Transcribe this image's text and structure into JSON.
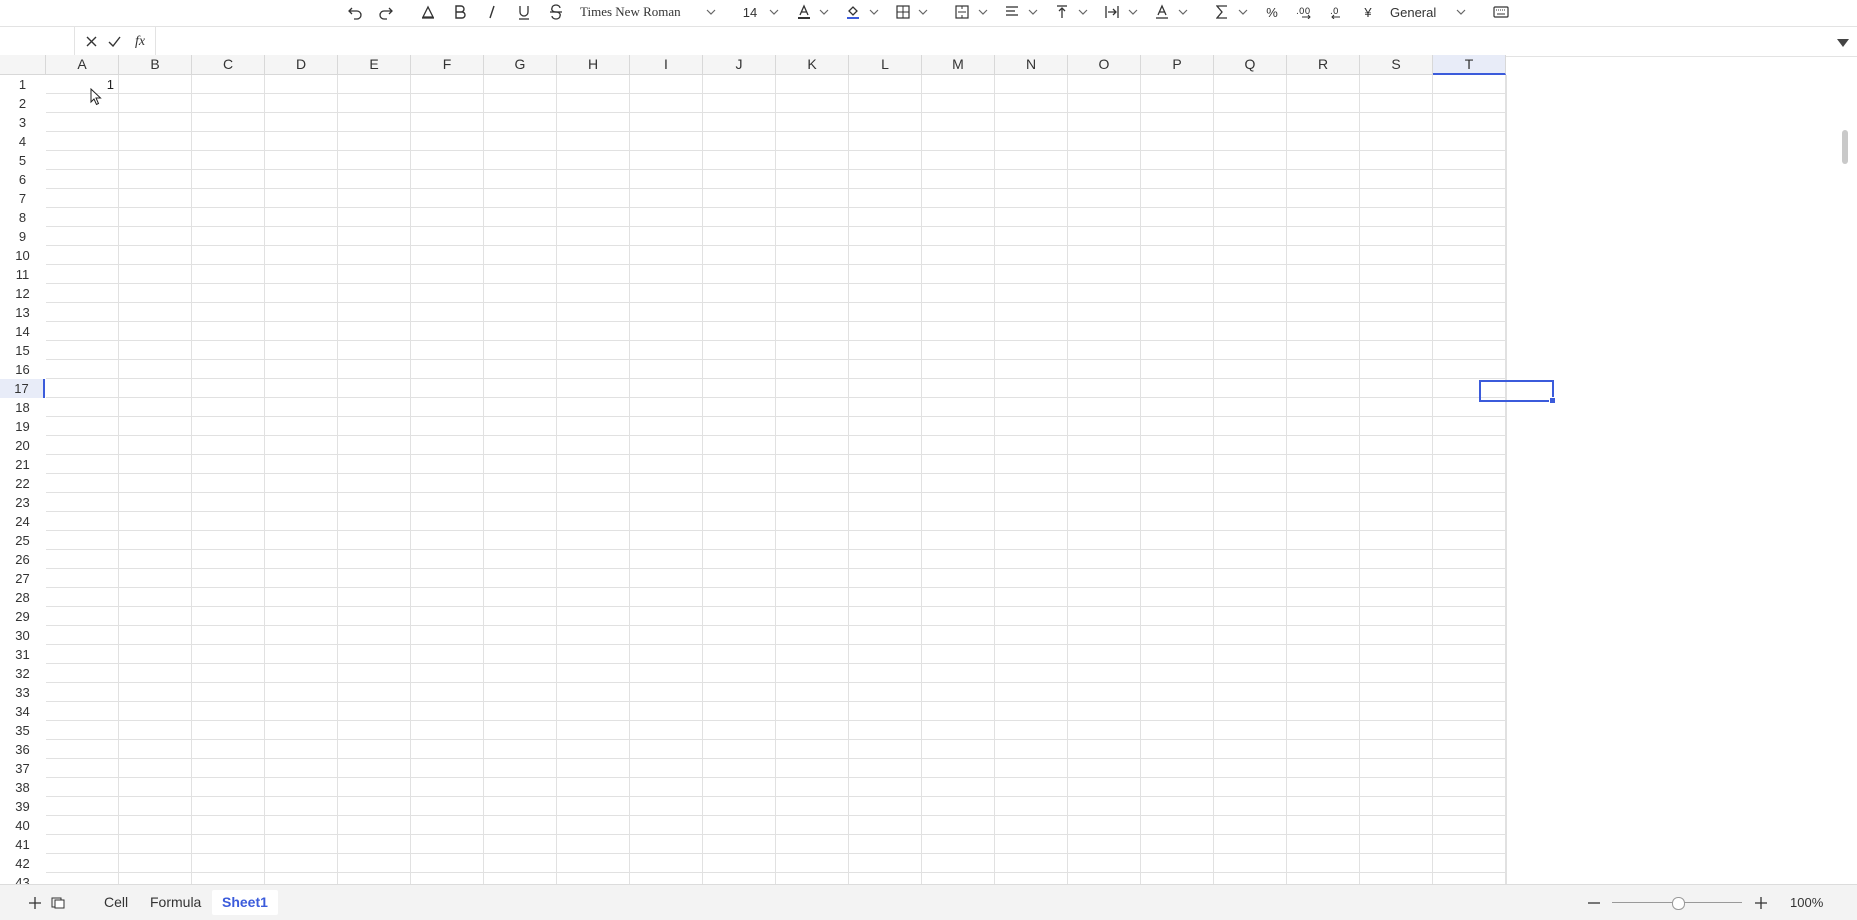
{
  "toolbar": {
    "font_name": "Times New Roman",
    "font_size": "14",
    "number_format": "General",
    "currency_symbol": "¥",
    "percent_symbol": "%"
  },
  "formula_bar": {
    "cell_reference": "",
    "formula": "",
    "fx_label": "fx"
  },
  "grid": {
    "columns": [
      "A",
      "B",
      "C",
      "D",
      "E",
      "F",
      "G",
      "H",
      "I",
      "J",
      "K",
      "L",
      "M",
      "N",
      "O",
      "P",
      "Q",
      "R",
      "S",
      "T"
    ],
    "rows": [
      "1",
      "2",
      "3",
      "4",
      "5",
      "6",
      "7",
      "8",
      "9",
      "10",
      "11",
      "12",
      "13",
      "14",
      "15",
      "16",
      "17",
      "18",
      "19",
      "20",
      "21",
      "22",
      "23",
      "24",
      "25",
      "26",
      "27",
      "28",
      "29",
      "30",
      "31",
      "32",
      "33",
      "34",
      "35",
      "36",
      "37",
      "38",
      "39",
      "40",
      "41",
      "42",
      "43"
    ],
    "cell_a1": "1",
    "selected_cell": "T17",
    "selected_column": "T",
    "selected_row": "17"
  },
  "sheets": {
    "tabs": [
      "Cell",
      "Formula",
      "Sheet1"
    ],
    "active": "Sheet1"
  },
  "zoom": {
    "label": "100%",
    "level_percent": 100
  },
  "colors": {
    "accent": "#3b5bdb",
    "grid_line": "#e1e1e1"
  }
}
